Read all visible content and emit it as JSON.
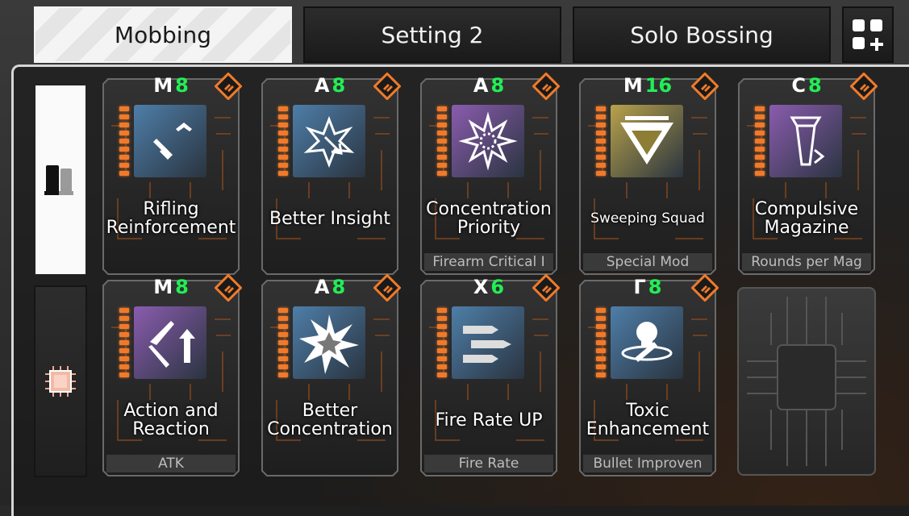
{
  "tabs": [
    {
      "label": "Mobbing",
      "active": true
    },
    {
      "label": "Setting 2",
      "active": false
    },
    {
      "label": "Solo Bossing",
      "active": false
    }
  ],
  "add_tab_icon": "grid-plus-icon",
  "sidebar": [
    {
      "icon": "bullet-cartridge-icon",
      "selected": true
    },
    {
      "icon": "chip-icon",
      "selected": false
    }
  ],
  "cards": [
    {
      "title": "Rifling Reinforcement",
      "symbol": "M",
      "level": "8",
      "subtitle": "",
      "icon_color": "#4e7ea8",
      "icon": "bullet-up-icon"
    },
    {
      "title": "Better Insight",
      "symbol": "A",
      "level": "8",
      "subtitle": "",
      "icon_color": "#4e7ea8",
      "icon": "burst-arrow-icon"
    },
    {
      "title": "Concentration Priority",
      "symbol": "A",
      "level": "8",
      "subtitle": "Firearm Critical I",
      "icon_color": "#8a5cae",
      "icon": "starburst-icon"
    },
    {
      "title": "Sweeping Squad",
      "symbol": "M",
      "level": "16",
      "subtitle": "Special Mod",
      "icon_color": "#b8a24a",
      "icon": "shield-triangle-icon"
    },
    {
      "title": "Compulsive Magazine",
      "symbol": "C",
      "level": "8",
      "subtitle": "Rounds per Mag",
      "icon_color": "#8a5cae",
      "icon": "magazine-icon"
    },
    {
      "title": "Action and Reaction",
      "symbol": "M",
      "level": "8",
      "subtitle": "ATK",
      "icon_color": "#8a5cae",
      "icon": "arrows-icon"
    },
    {
      "title": "Better Concentration",
      "symbol": "A",
      "level": "8",
      "subtitle": "",
      "icon_color": "#4e7ea8",
      "icon": "burst-icon"
    },
    {
      "title": "Fire Rate UP",
      "symbol": "X",
      "level": "6",
      "subtitle": "Fire Rate",
      "icon_color": "#4e7ea8",
      "icon": "bullets-icon"
    },
    {
      "title": "Toxic Enhancement",
      "symbol": "Γ",
      "level": "8",
      "subtitle": "Bullet Improven",
      "icon_color": "#4e7ea8",
      "icon": "skull-bullet-icon"
    }
  ],
  "empty_slot_icon": "circuit-chip-icon",
  "colors": {
    "led": "#f07a2a",
    "level": "#22ee55"
  }
}
